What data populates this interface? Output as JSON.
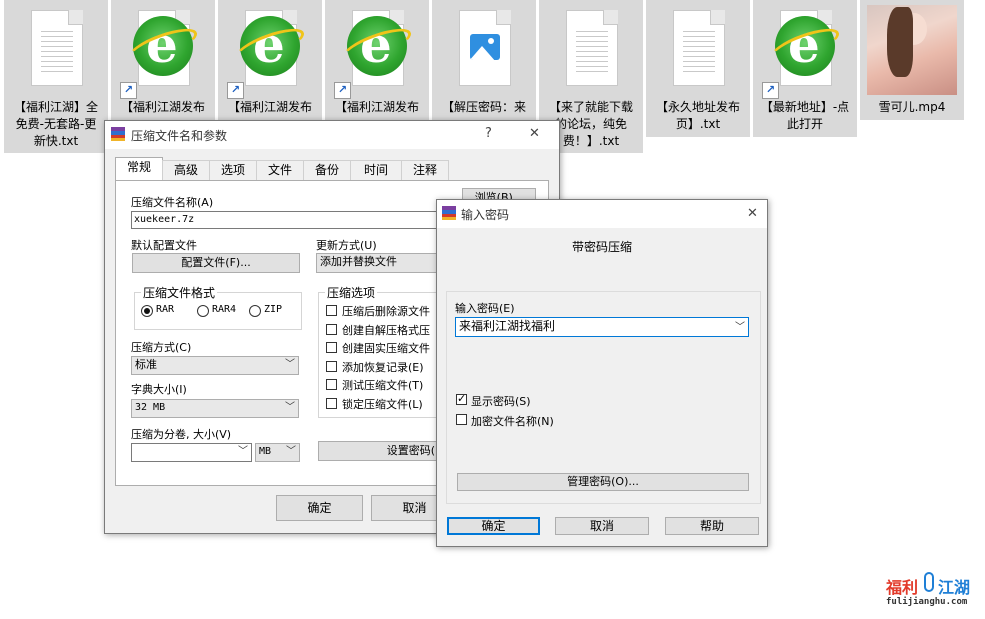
{
  "desktop": {
    "files": [
      {
        "name": "【福利江湖】全免费-无套路-更新快.txt",
        "lines": [
          "【福利江湖】全",
          "免费-无套路-更",
          "新快.txt"
        ],
        "icon": "text-document-icon",
        "shortcut": false
      },
      {
        "name": "【福利江湖发布",
        "lines": [
          "【福利江湖发布"
        ],
        "icon": "internet-explorer-icon",
        "shortcut": true
      },
      {
        "name": "【福利江湖发布",
        "lines": [
          "【福利江湖发布"
        ],
        "icon": "internet-explorer-icon",
        "shortcut": true
      },
      {
        "name": "【福利江湖发布",
        "lines": [
          "【福利江湖发布"
        ],
        "icon": "internet-explorer-icon",
        "shortcut": true
      },
      {
        "name": "【解压密码：来",
        "lines": [
          "【解压密码：来"
        ],
        "icon": "image-file-icon",
        "shortcut": false
      },
      {
        "name": "【来了就能下载的论坛，纯免费！】.txt",
        "lines": [
          "【来了就能下载",
          "的论坛，纯免",
          "费！】.txt"
        ],
        "icon": "text-document-icon",
        "shortcut": false
      },
      {
        "name": "【永久地址发布页】.txt",
        "lines": [
          "【永久地址发布",
          "页】.txt"
        ],
        "icon": "text-document-icon",
        "shortcut": false
      },
      {
        "name": "【最新地址】-点此打开",
        "lines": [
          "【最新地址】-点",
          "此打开"
        ],
        "icon": "internet-explorer-icon",
        "shortcut": true
      },
      {
        "name": "雪可儿.mp4",
        "lines": [
          "雪可儿.mp4"
        ],
        "icon": "video-thumbnail",
        "shortcut": false
      }
    ],
    "shortcut_glyph": "↗"
  },
  "archive_dialog": {
    "title": "压缩文件名和参数",
    "help_glyph": "?",
    "close_glyph": "✕",
    "tabs": [
      "常规",
      "高级",
      "选项",
      "文件",
      "备份",
      "时间",
      "注释"
    ],
    "active_tab": "常规",
    "archive_name_label": "压缩文件名称(A)",
    "archive_name_value": "xuekeer.7z",
    "browse_label": "浏览(B)...",
    "default_profile_label": "默认配置文件",
    "profiles_button": "配置文件(F)...",
    "update_mode_label": "更新方式(U)",
    "update_mode_value": "添加并替换文件",
    "format_group_title": "压缩文件格式",
    "formats": [
      "RAR",
      "RAR4",
      "ZIP"
    ],
    "selected_format": "RAR",
    "method_label": "压缩方式(C)",
    "method_value": "标准",
    "dict_label": "字典大小(I)",
    "dict_value": "32 MB",
    "split_label": "压缩为分卷, 大小(V)",
    "split_value": "",
    "split_unit": "MB",
    "options_group_title": "压缩选项",
    "options": [
      "压缩后删除源文件",
      "创建自解压格式压",
      "创建固实压缩文件",
      "添加恢复记录(E)",
      "测试压缩文件(T)",
      "锁定压缩文件(L)"
    ],
    "set_password_button": "设置密码(",
    "ok_button": "确定",
    "cancel_button": "取消"
  },
  "password_dialog": {
    "title": "输入密码",
    "close_glyph": "✕",
    "heading": "带密码压缩",
    "password_label": "输入密码(E)",
    "password_value": "来福利江湖找福利",
    "show_password_label": "显示密码(S)",
    "show_password_checked": true,
    "encrypt_names_label": "加密文件名称(N)",
    "encrypt_names_checked": false,
    "organize_button": "管理密码(O)...",
    "ok_button": "确定",
    "cancel_button": "取消",
    "help_button": "帮助"
  },
  "watermark": {
    "text_left": "福利",
    "text_right": "江湖",
    "url": "fulijianghu.com"
  },
  "colors": {
    "accent": "#0078d7",
    "desktop_tile": "#d9d9d9",
    "ie_green": "#2fa52f",
    "watermark_red": "#e23a2a",
    "watermark_blue": "#1f7fd6"
  }
}
